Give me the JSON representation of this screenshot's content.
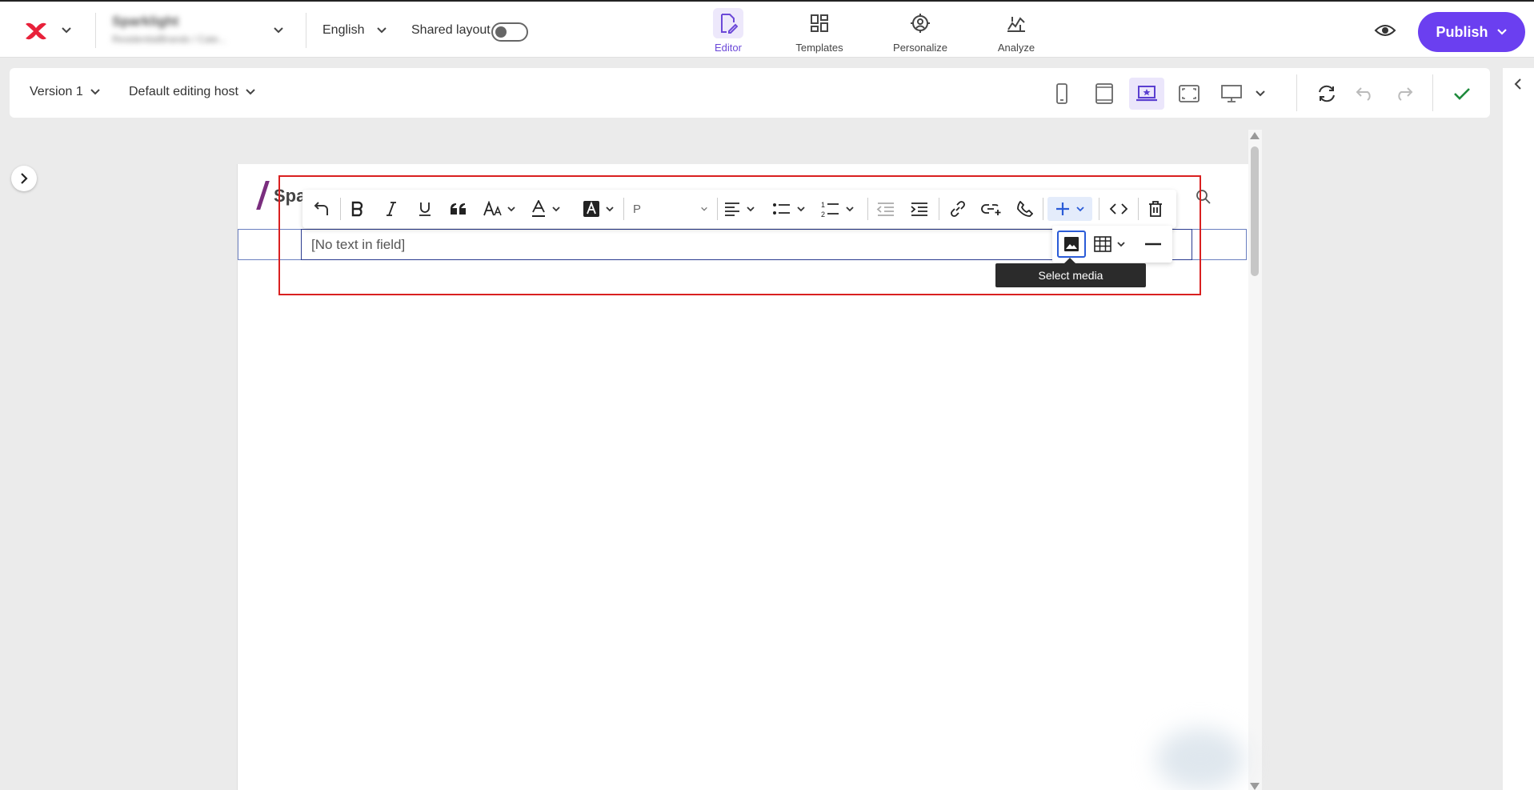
{
  "header": {
    "site_name": "Sparklight",
    "site_path": "ResidentialBrands / Cate...",
    "language": "English",
    "shared_layout_label": "Shared layout",
    "shared_layout_on": false,
    "nav": [
      {
        "label": "Editor",
        "icon": "editor-icon",
        "active": true
      },
      {
        "label": "Templates",
        "icon": "templates-icon",
        "active": false
      },
      {
        "label": "Personalize",
        "icon": "personalize-icon",
        "active": false
      },
      {
        "label": "Analyze",
        "icon": "analyze-icon",
        "active": false
      }
    ],
    "publish_label": "Publish",
    "accent_color": "#6b3ff0"
  },
  "toolbar": {
    "version_label": "Version 1",
    "editing_host_label": "Default editing host",
    "active_device": "laptop"
  },
  "canvas": {
    "brand_text": "Spa",
    "field_placeholder": "[No text in field]",
    "paragraph_format": "P"
  },
  "insert_menu": {
    "tooltip": "Select media"
  }
}
